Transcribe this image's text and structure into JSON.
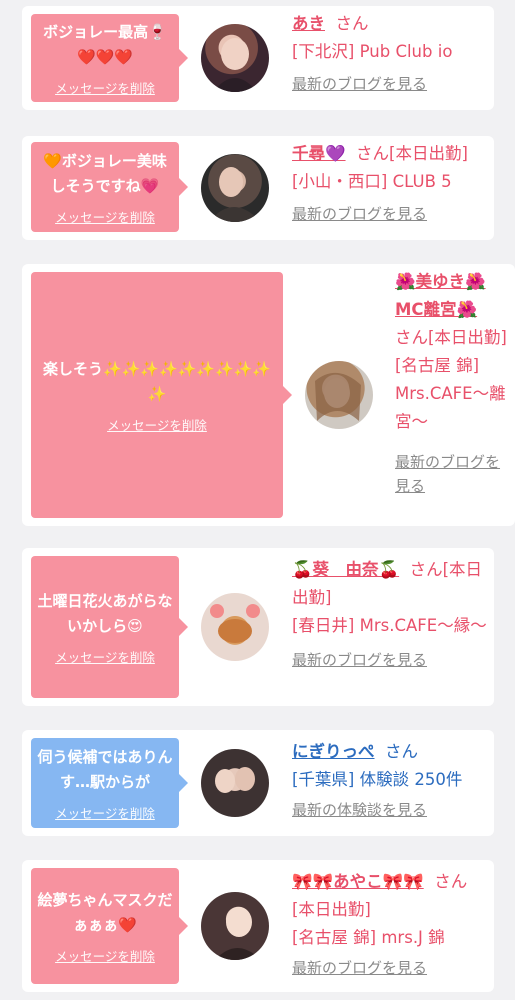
{
  "items": [
    {
      "message": "ボジョレー最高🍷❤️❤️❤️",
      "delete_label": "メッセージを削除",
      "name": "あき",
      "san": "さん",
      "shop": "[下北沢] Pub Club io",
      "blog_link": "最新のブログを見る"
    },
    {
      "message": "🧡ボジョレー美味しそうですね💗",
      "delete_label": "メッセージを削除",
      "name": "千尋💜",
      "san": "さん[本日出勤]",
      "shop": "[小山・西口] CLUB 5",
      "blog_link": "最新のブログを見る"
    },
    {
      "message": "楽しそう✨✨✨✨✨✨✨✨✨✨",
      "delete_label": "メッセージを削除",
      "name": "🌺美ゆき🌺MC離宮🌺",
      "san": "さん[本日出勤]",
      "shop": "[名古屋 錦] Mrs.CAFE〜離宮〜",
      "blog_link": "最新のブログを見る"
    },
    {
      "message": "土曜日花火あがらないかしら😍",
      "delete_label": "メッセージを削除",
      "name": "🍒葵　由奈🍒",
      "san": "さん[本日出勤]",
      "shop": "[春日井] Mrs.CAFE〜縁〜",
      "blog_link": "最新のブログを見る"
    },
    {
      "message": "伺う候補ではありんす…駅からが",
      "delete_label": "メッセージを削除",
      "name": "にぎりっぺ",
      "san": "さん",
      "shop": "[千葉県] 体験談 250件",
      "blog_link": "最新の体験談を見る"
    },
    {
      "message": "絵夢ちゃんマスクだぁぁぁ❤️",
      "delete_label": "メッセージを削除",
      "name": "🎀🎀あやこ🎀🎀",
      "san": "さん[本日出勤]",
      "shop": "[名古屋 錦] mrs.J 錦",
      "blog_link": "最新のブログを見る"
    }
  ],
  "colors": {
    "bubble_pink": "#f7929f",
    "bubble_blue": "#86b7f2",
    "name_pink": "#e8506a",
    "name_blue": "#2c6cbf",
    "link_gray": "#8a8a8a"
  },
  "icons": [
    "avatar-photo"
  ]
}
